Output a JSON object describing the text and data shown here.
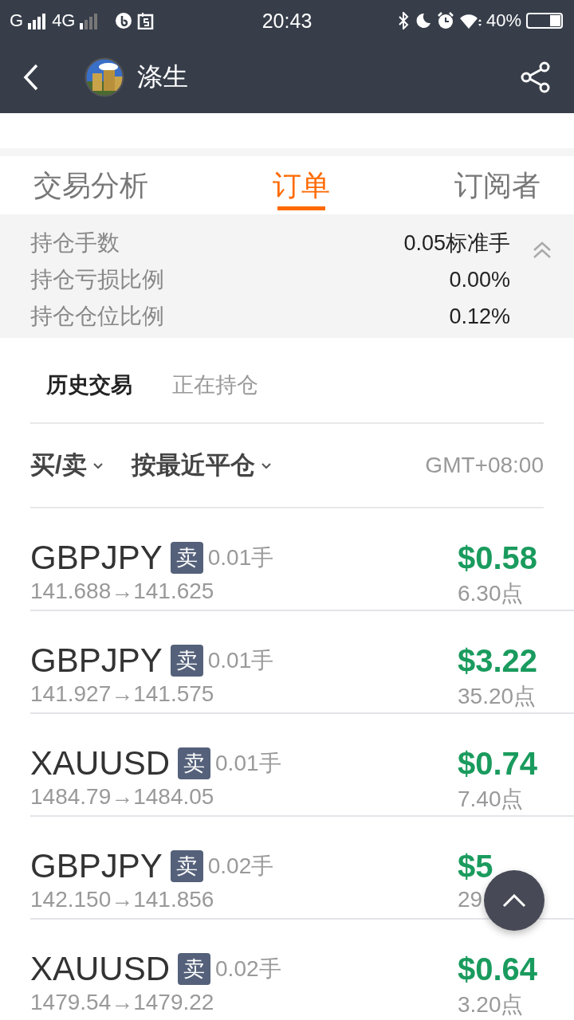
{
  "status_bar": {
    "sim1": "G",
    "sim2": "4G",
    "time": "20:43",
    "battery": "40%"
  },
  "header": {
    "title": "涤生"
  },
  "tabs": [
    {
      "label": "交易分析",
      "selected": false
    },
    {
      "label": "订单",
      "selected": true
    },
    {
      "label": "订阅者",
      "selected": false
    }
  ],
  "summary": [
    {
      "label": "持仓手数",
      "value": "0.05标准手"
    },
    {
      "label": "持仓亏损比例",
      "value": "0.00%"
    },
    {
      "label": "持仓仓位比例",
      "value": "0.12%"
    }
  ],
  "subtabs": [
    {
      "label": "历史交易",
      "selected": true
    },
    {
      "label": "正在持仓",
      "selected": false
    }
  ],
  "filters": [
    {
      "label": "买/卖"
    },
    {
      "label": "按最近平仓"
    }
  ],
  "timezone": "GMT+08:00",
  "trades": [
    {
      "symbol": "GBPJPY",
      "side": "卖",
      "lots": "0.01手",
      "prices": "141.688→141.625",
      "profit": "$0.58",
      "points": "6.30点"
    },
    {
      "symbol": "GBPJPY",
      "side": "卖",
      "lots": "0.01手",
      "prices": "141.927→141.575",
      "profit": "$3.22",
      "points": "35.20点"
    },
    {
      "symbol": "XAUUSD",
      "side": "卖",
      "lots": "0.01手",
      "prices": "1484.79→1484.05",
      "profit": "$0.74",
      "points": "7.40点"
    },
    {
      "symbol": "GBPJPY",
      "side": "卖",
      "lots": "0.02手",
      "prices": "142.150→141.856",
      "profit": "$5",
      "points": "29"
    },
    {
      "symbol": "XAUUSD",
      "side": "卖",
      "lots": "0.02手",
      "prices": "1479.54→1479.22",
      "profit": "$0.64",
      "points": "3.20点"
    }
  ]
}
